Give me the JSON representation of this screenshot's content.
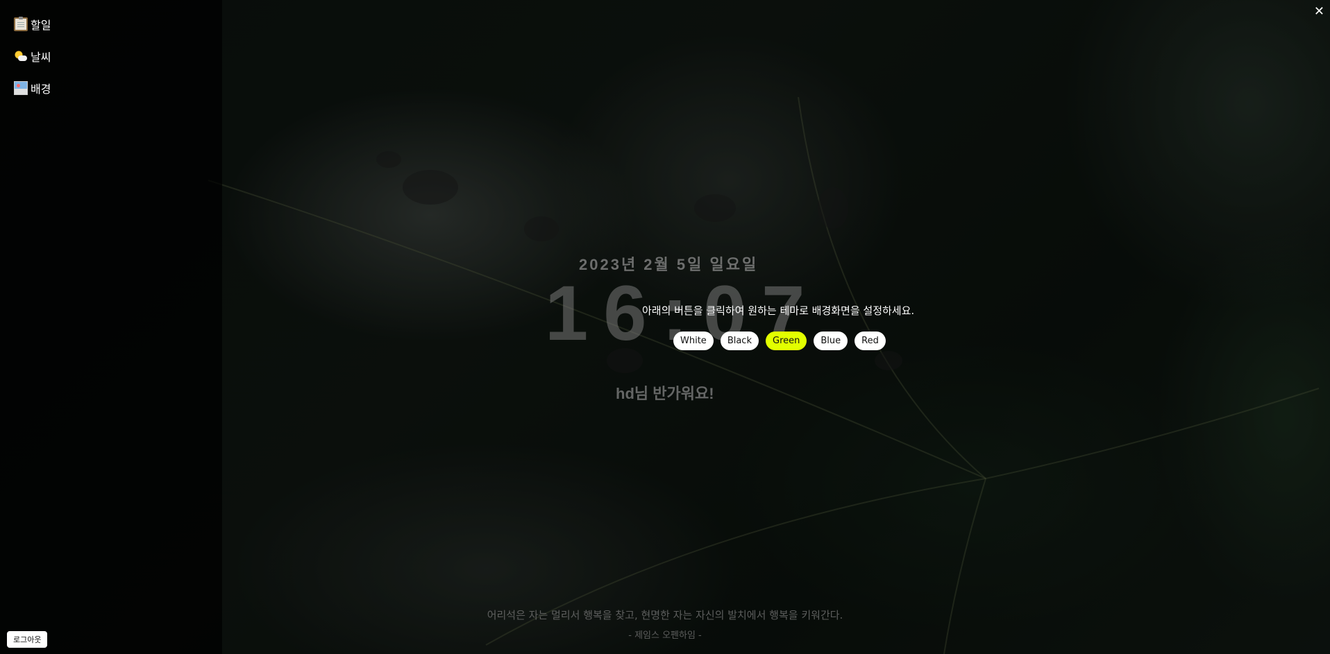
{
  "sidebar": {
    "items": [
      {
        "icon": "clipboard-icon",
        "label": "할일"
      },
      {
        "icon": "sun-cloud-icon",
        "label": "날씨"
      },
      {
        "icon": "picture-icon",
        "label": "배경"
      }
    ],
    "logout_label": "로그아웃"
  },
  "close_label": "✕",
  "main": {
    "date": "2023년 2월 5일 일요일",
    "time": "16:07",
    "greeting": "hd님 반가워요!",
    "quote": "어리석은 자는 멀리서 행복을 찾고, 현명한 자는 자신의 발치에서 행복을 키워간다.",
    "author": "- 제임스 오펜하임 -"
  },
  "theme": {
    "message": "아래의 버튼을 클릭하여 원하는 테마로 배경화면을 설정하세요.",
    "buttons": [
      "White",
      "Black",
      "Green",
      "Blue",
      "Red"
    ],
    "selected": "Green",
    "accent_color": "#e2ff00"
  }
}
